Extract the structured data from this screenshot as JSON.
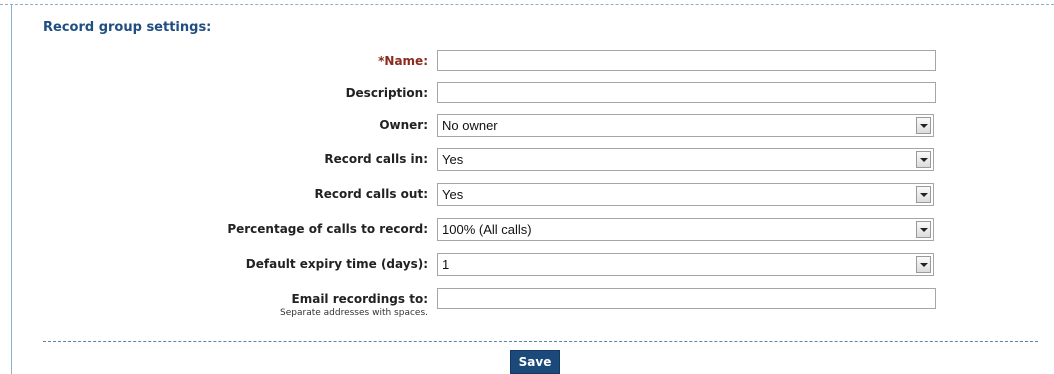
{
  "section": {
    "title": "Record group settings:"
  },
  "form": {
    "name": {
      "label": "*Name:",
      "value": ""
    },
    "description": {
      "label": "Description:",
      "value": ""
    },
    "owner": {
      "label": "Owner:",
      "value": "No owner"
    },
    "record_calls_in": {
      "label": "Record calls in:",
      "value": "Yes"
    },
    "record_calls_out": {
      "label": "Record calls out:",
      "value": "Yes"
    },
    "percentage": {
      "label": "Percentage of calls to record:",
      "value": "100% (All calls)"
    },
    "expiry": {
      "label": "Default expiry time (days):",
      "value": "1"
    },
    "email": {
      "label": "Email recordings to:",
      "hint": "Separate addresses with spaces.",
      "value": ""
    }
  },
  "actions": {
    "save_label": "Save"
  },
  "colors": {
    "title": "#1f4f82",
    "required_label": "#8a2b1d",
    "save_button": "#1b4a7a"
  }
}
